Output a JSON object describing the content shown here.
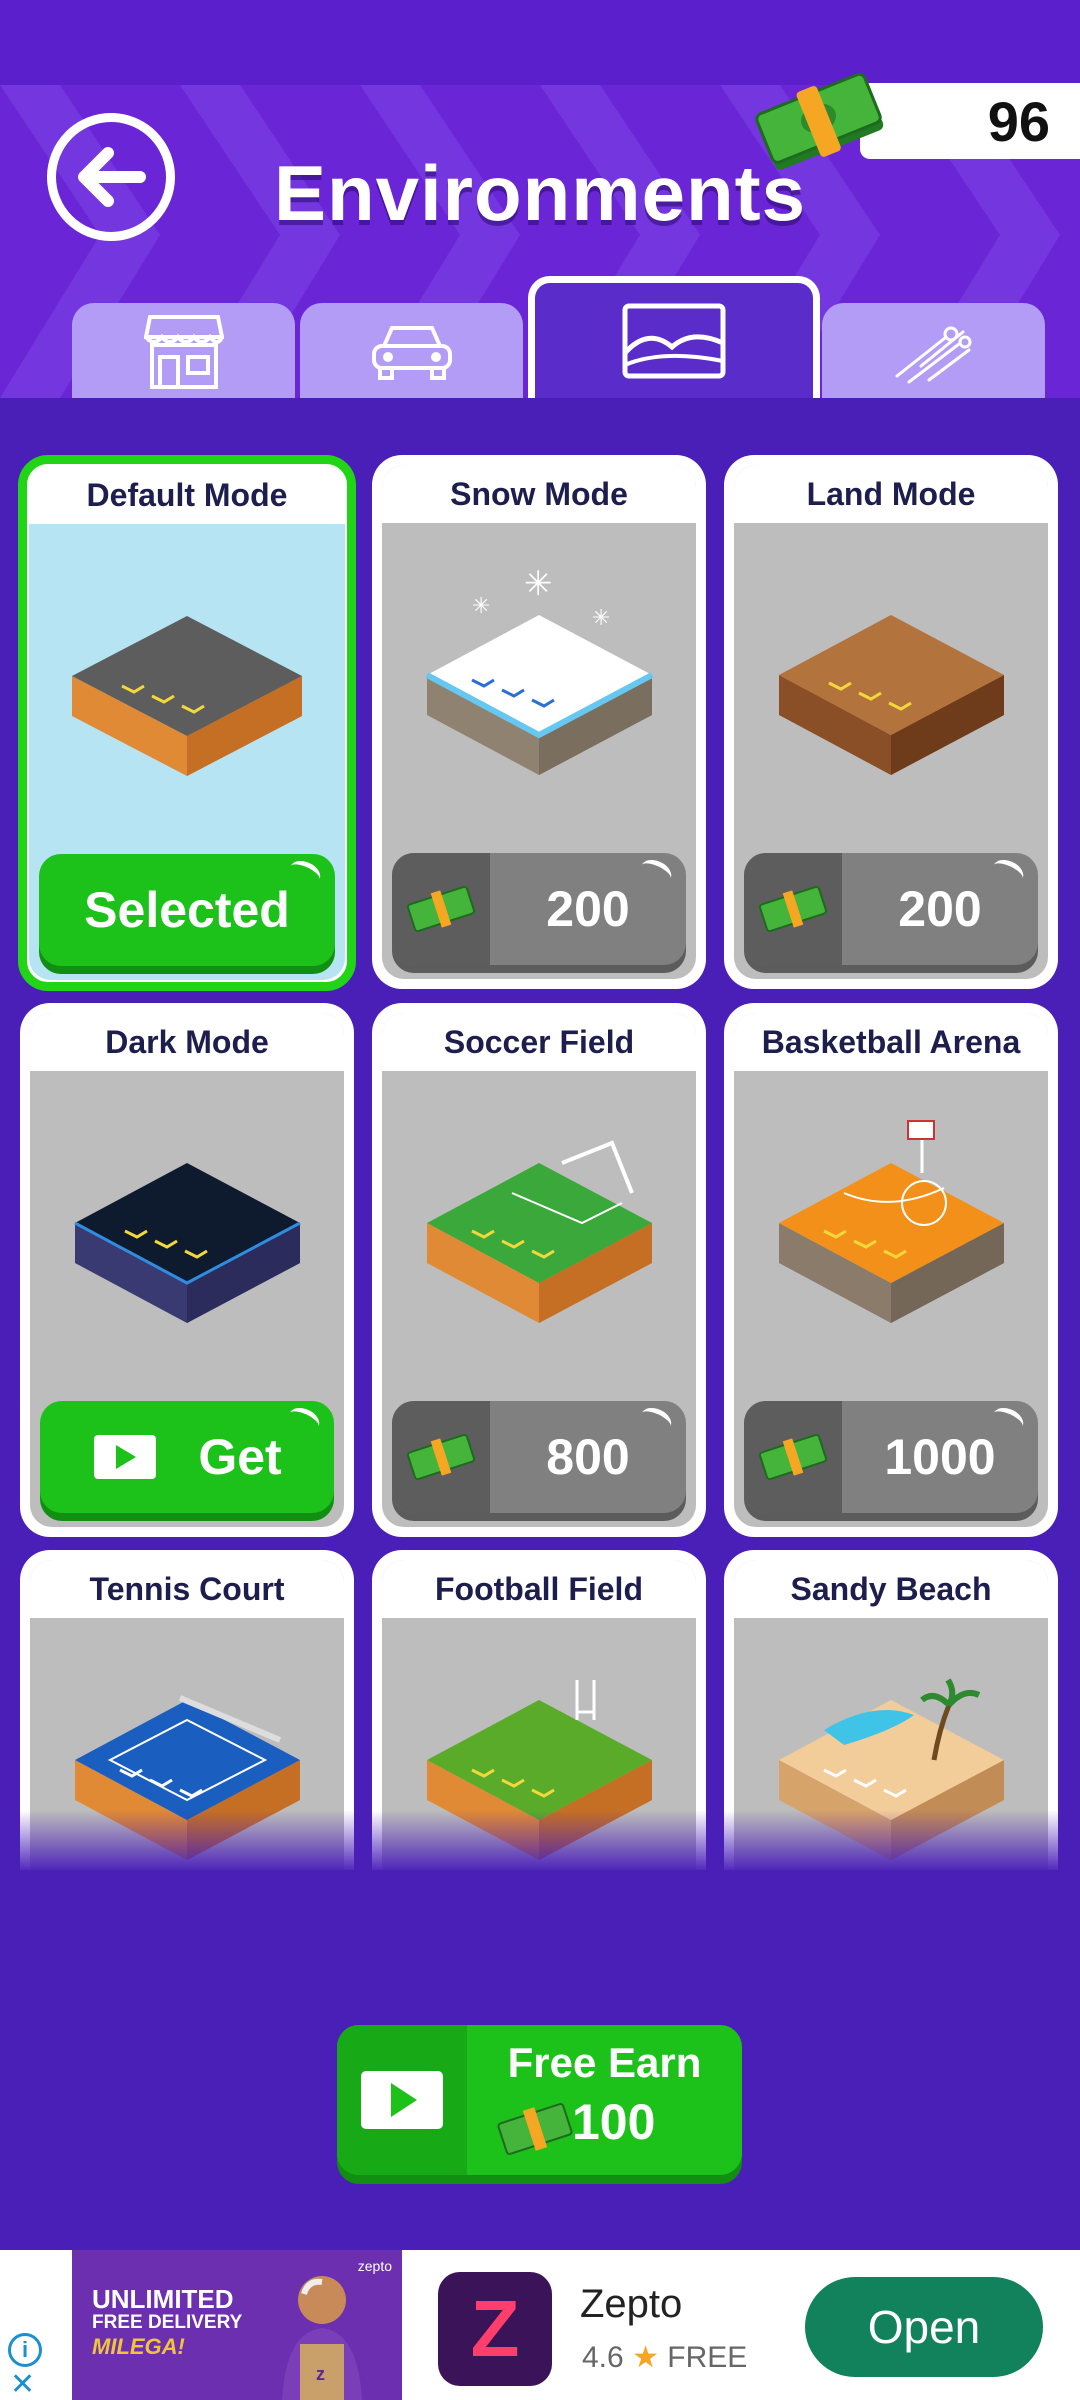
{
  "header": {
    "title": "Environments",
    "currency_amount": "96"
  },
  "tabs": [
    {
      "name": "shop",
      "icon": "storefront-icon",
      "active": false
    },
    {
      "name": "vehicles",
      "icon": "car-icon",
      "active": false
    },
    {
      "name": "environments",
      "icon": "landscape-icon",
      "active": true
    },
    {
      "name": "effects",
      "icon": "comet-icon",
      "active": false
    }
  ],
  "environments": [
    {
      "name": "Default Mode",
      "status": "selected",
      "button_label": "Selected"
    },
    {
      "name": "Snow Mode",
      "price": "200"
    },
    {
      "name": "Land Mode",
      "price": "200"
    },
    {
      "name": "Dark Mode",
      "status": "get",
      "button_label": "Get"
    },
    {
      "name": "Soccer Field",
      "price": "800"
    },
    {
      "name": "Basketball Arena",
      "price": "1000"
    },
    {
      "name": "Tennis Court"
    },
    {
      "name": "Football Field"
    },
    {
      "name": "Sandy Beach"
    }
  ],
  "free_earn": {
    "label": "Free Earn",
    "amount": "100"
  },
  "ad": {
    "banner_line1": "UNLIMITED",
    "banner_line2": "FREE DELIVERY",
    "banner_line3": "MILEGA!",
    "banner_brand": "zepto",
    "app_name": "Zepto",
    "rating": "4.6",
    "price": "FREE",
    "cta": "Open",
    "logo_letter": "Z"
  },
  "colors": {
    "background": "#4a1fb8",
    "header": "#6a26d6",
    "green": "#1cc21a",
    "tab_inactive": "#b39cf5",
    "price_button": "#808080"
  }
}
